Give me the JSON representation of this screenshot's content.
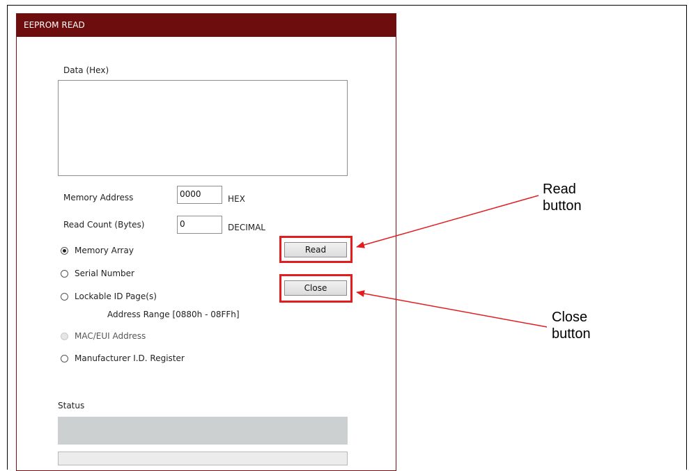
{
  "dialog": {
    "title": "EEPROM READ",
    "data_label": "Data (Hex)",
    "memory_address_label": "Memory Address",
    "memory_address_value": "0000",
    "memory_address_unit": "HEX",
    "read_count_label": "Read Count (Bytes)",
    "read_count_value": "0",
    "read_count_unit": "DECIMAL",
    "options": [
      {
        "label": "Memory Array",
        "checked": true,
        "enabled": true
      },
      {
        "label": "Serial Number",
        "checked": false,
        "enabled": true
      },
      {
        "label": "Lockable ID Page(s)",
        "checked": false,
        "enabled": true
      },
      {
        "label": "MAC/EUI Address",
        "checked": false,
        "enabled": false
      },
      {
        "label": "Manufacturer I.D. Register",
        "checked": false,
        "enabled": true
      }
    ],
    "address_range_note": "Address Range [0880h - 08FFh]",
    "read_button": "Read",
    "close_button": "Close",
    "status_label": "Status"
  },
  "annotations": {
    "read_callout": [
      "Read",
      "button"
    ],
    "close_callout": [
      "Close",
      "button"
    ],
    "color": "#e11d1d"
  }
}
